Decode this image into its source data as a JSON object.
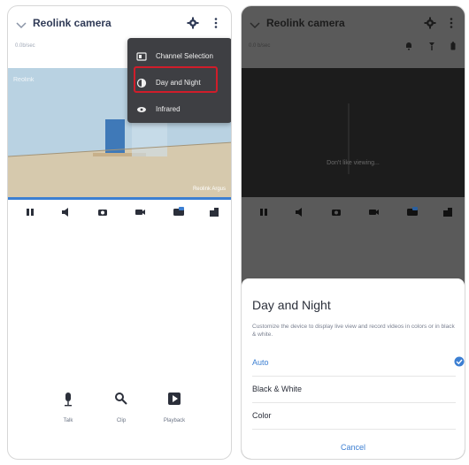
{
  "left_screen": {
    "app_title": "Reolink camera",
    "subtitle": "0.0b/sec",
    "video_timestamp": "Reolink",
    "video_watermark": "Reolink Argus",
    "menu": {
      "items": [
        {
          "label": "Channel Selection",
          "icon": "channel-icon"
        },
        {
          "label": "Day and Night",
          "icon": "day-night-icon"
        },
        {
          "label": "Infrared",
          "icon": "infrared-icon"
        }
      ]
    },
    "actions": [
      {
        "label": "Talk",
        "icon": "microphone-icon"
      },
      {
        "label": "Clip",
        "icon": "clip-icon"
      },
      {
        "label": "Playback",
        "icon": "playback-icon"
      }
    ]
  },
  "right_screen": {
    "app_title": "Reolink camera",
    "subtitle": "0.0 b/sec",
    "video_status": "Don't like viewing...",
    "sheet": {
      "title": "Day and Night",
      "description": "Customize the device to display live view and record videos in colors or in black & white.",
      "options": [
        {
          "label": "Auto",
          "selected": true
        },
        {
          "label": "Black & White",
          "selected": false
        },
        {
          "label": "Color",
          "selected": false
        }
      ],
      "cancel_label": "Cancel"
    }
  },
  "colors": {
    "accent": "#3c7fd2",
    "highlight": "#d01d2a",
    "menu_bg": "#3e3f43"
  }
}
